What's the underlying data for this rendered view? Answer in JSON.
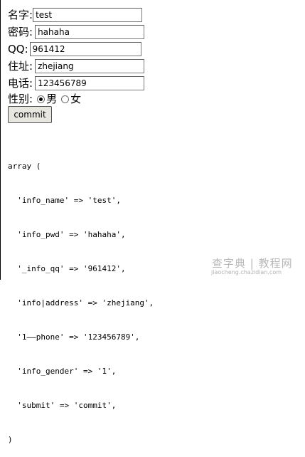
{
  "form": {
    "name_label": "名字:",
    "name_value": "test",
    "pwd_label": "密码:",
    "pwd_value": "hahaha",
    "qq_label": "QQ:",
    "qq_value": "961412",
    "address_label": "住址:",
    "address_value": "zhejiang",
    "phone_label": "电话:",
    "phone_value": "123456789",
    "gender_label": "性别:",
    "gender_male_label": "男",
    "gender_female_label": "女",
    "gender_selected": "男",
    "submit_label": "commit"
  },
  "output": {
    "lines": [
      "array (",
      "  'info_name' => 'test',",
      "  'info_pwd' => 'hahaha',",
      "  '_info_qq' => '961412',",
      "  'info|address' => 'zhejiang',",
      "  '1——phone' => '123456789',",
      "  'info_gender' => '1',",
      "  'submit' => 'commit',",
      ")"
    ]
  },
  "watermark": {
    "main": "查字典 | 教程网",
    "sub": "jiaocheng.chazidian.com"
  }
}
